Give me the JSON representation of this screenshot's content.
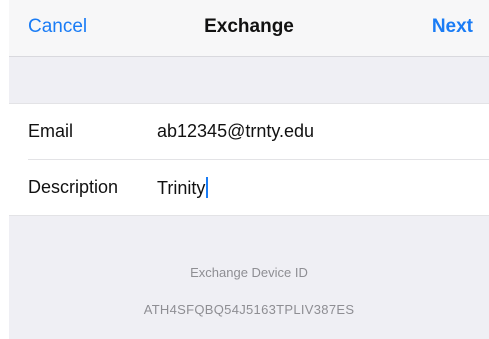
{
  "nav": {
    "cancel_label": "Cancel",
    "title": "Exchange",
    "next_label": "Next"
  },
  "form": {
    "email": {
      "label": "Email",
      "value": "ab12345@trnty.edu"
    },
    "description": {
      "label": "Description",
      "value": "Trinity"
    }
  },
  "footer": {
    "device_id_title": "Exchange Device ID",
    "device_id_value": "ATH4SFQBQ54J5163TPLIV387ES"
  },
  "colors": {
    "accent": "#1a7cf5",
    "background": "#efeff4",
    "secondary_text": "#8e8e93"
  }
}
